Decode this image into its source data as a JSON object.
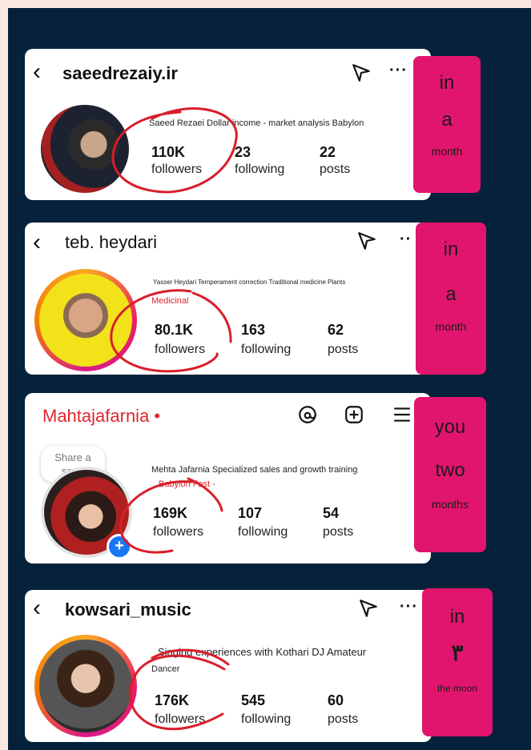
{
  "profiles": [
    {
      "username": "saeedrezaiy.ir",
      "bio_line1": "Saeed Rezaei Dollar income - market analysis Babylon",
      "bio_line2": "",
      "followers_count": "110K",
      "followers_label": "followers",
      "following_count": "23",
      "following_label": "following",
      "posts_count": "22",
      "posts_label": "posts",
      "tag_lines": [
        "in",
        "a",
        "month"
      ]
    },
    {
      "username": "teb. heydari",
      "bio_line1": "Yasser Heydari Temperament correction Traditional medicine Plants",
      "bio_line2": "Medicinal",
      "followers_count": "80.1K",
      "followers_label": "followers",
      "following_count": "163",
      "following_label": "following",
      "posts_count": "62",
      "posts_label": "posts",
      "tag_lines": [
        "in",
        "a",
        "month"
      ]
    },
    {
      "username": "Mahtajafarnia •",
      "song_bubble": "Share a song",
      "bio_line1": "Mehta Jafarnia Specialized sales and growth training",
      "bio_line2": "Babylon Fast -",
      "followers_count": "169K",
      "followers_label": "followers",
      "following_count": "107",
      "following_label": "following",
      "posts_count": "54",
      "posts_label": "posts",
      "tag_lines": [
        "you",
        "two",
        "months"
      ]
    },
    {
      "username": "kowsari_music",
      "bio_line1": "Singing experiences with Kothari DJ Amateur",
      "bio_line2": "Dancer",
      "followers_count": "176K",
      "followers_label": "followers",
      "following_count": "545",
      "following_label": "following",
      "posts_count": "60",
      "posts_label": "posts",
      "tag_lines": [
        "in",
        "۳",
        "the moon"
      ]
    }
  ],
  "icons": {
    "back": "chevron-left-icon",
    "send": "send-icon",
    "more": "more-dots-icon",
    "threads": "threads-icon",
    "add": "add-post-icon",
    "menu": "hamburger-menu-icon"
  },
  "colors": {
    "background": "#05223a",
    "tag": "#e2156e",
    "annotation": "#d91e2a",
    "username_red": "#e0262e"
  }
}
